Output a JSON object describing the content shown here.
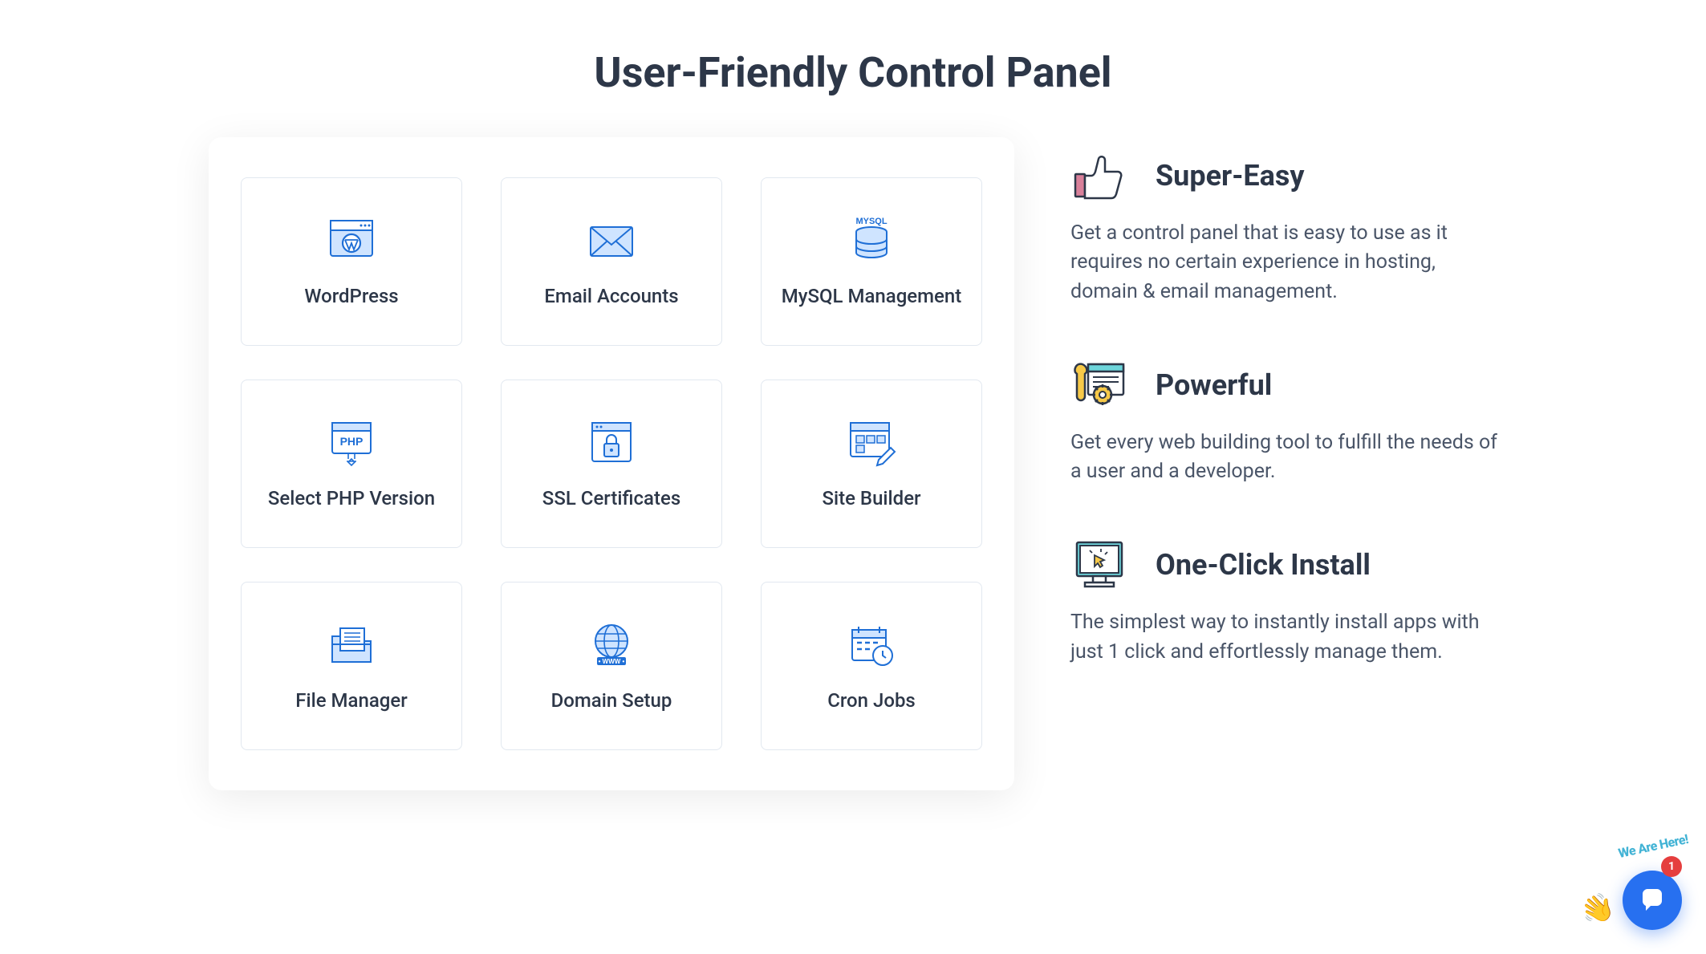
{
  "title": "User-Friendly Control Panel",
  "panel": {
    "items": [
      {
        "label": "WordPress",
        "icon": "wordpress-icon"
      },
      {
        "label": "Email Accounts",
        "icon": "email-icon"
      },
      {
        "label": "MySQL Management",
        "icon": "mysql-icon"
      },
      {
        "label": "Select PHP Version",
        "icon": "php-icon"
      },
      {
        "label": "SSL Certificates",
        "icon": "ssl-icon"
      },
      {
        "label": "Site Builder",
        "icon": "site-builder-icon"
      },
      {
        "label": "File Manager",
        "icon": "file-manager-icon"
      },
      {
        "label": "Domain Setup",
        "icon": "domain-icon"
      },
      {
        "label": "Cron Jobs",
        "icon": "cron-icon"
      }
    ]
  },
  "features": [
    {
      "title": "Super-Easy",
      "description": "Get a control panel that is easy to use as it requires no certain experience in hosting, domain & email management.",
      "icon": "thumbs-up-icon"
    },
    {
      "title": "Powerful",
      "description": "Get every web building tool to fulfill the needs of a user and a developer.",
      "icon": "wrench-gear-icon"
    },
    {
      "title": "One-Click Install",
      "description": "The simplest way to instantly install apps with just 1 click and effortlessly manage them.",
      "icon": "click-monitor-icon"
    }
  ],
  "chat": {
    "badge": "1",
    "here_text": "We Are Here!"
  }
}
